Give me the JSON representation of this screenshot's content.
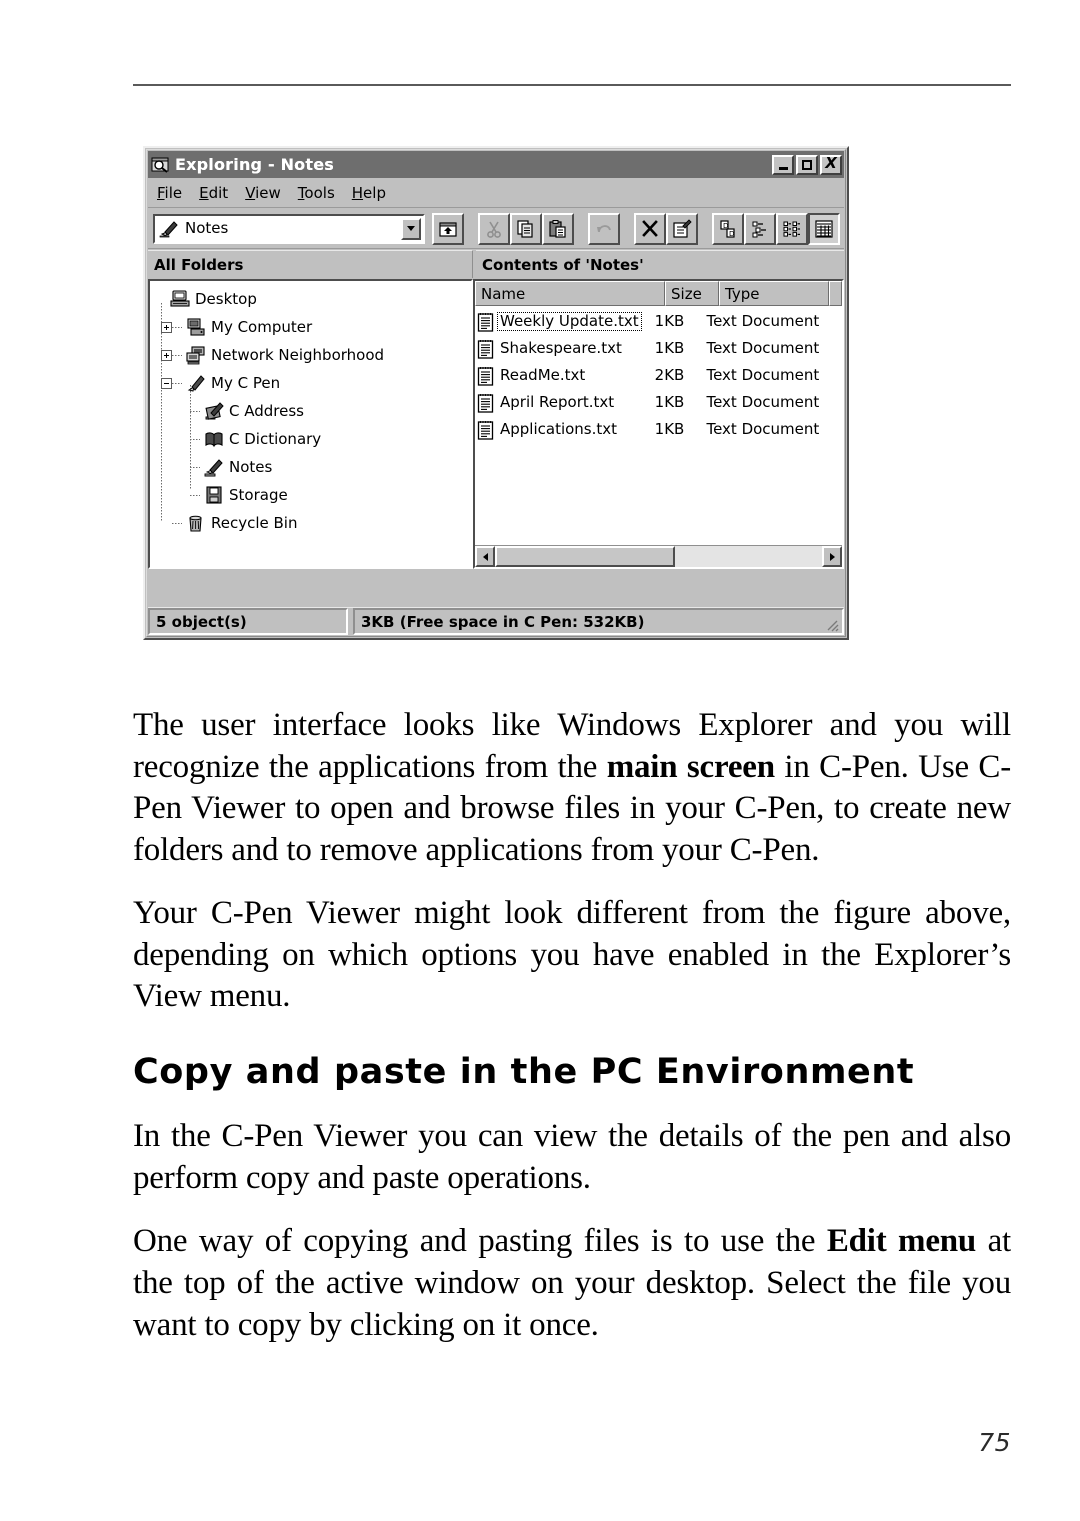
{
  "page": {
    "number": "75"
  },
  "window": {
    "title": "Exploring - Notes",
    "title_icon": "explorer-folder-magnifier-icon",
    "buttons": {
      "minimize": "minimize-button",
      "maximize": "maximize-button",
      "close": "close-button",
      "close_label": "X"
    },
    "menu": [
      {
        "label": "File",
        "accel": "F",
        "rest": "ile"
      },
      {
        "label": "Edit",
        "accel": "E",
        "rest": "dit"
      },
      {
        "label": "View",
        "accel": "V",
        "rest": "iew"
      },
      {
        "label": "Tools",
        "accel": "T",
        "rest": "ools"
      },
      {
        "label": "Help",
        "accel": "H",
        "rest": "elp"
      }
    ],
    "addressbar": {
      "value": "Notes",
      "icon": "notes-pen-icon",
      "dropdown": "chevron-down-icon"
    },
    "toolbar_buttons": [
      {
        "name": "up-one-level-button",
        "tooltip": "Up One Level",
        "enabled": true,
        "pressed": false
      },
      {
        "name": "cut-button",
        "tooltip": "Cut",
        "enabled": false,
        "pressed": false
      },
      {
        "name": "copy-button",
        "tooltip": "Copy",
        "enabled": true,
        "pressed": false
      },
      {
        "name": "paste-button",
        "tooltip": "Paste",
        "enabled": true,
        "pressed": false
      },
      {
        "name": "undo-button",
        "tooltip": "Undo",
        "enabled": false,
        "pressed": false
      },
      {
        "name": "delete-button",
        "tooltip": "Delete",
        "enabled": true,
        "pressed": false
      },
      {
        "name": "properties-button",
        "tooltip": "Properties",
        "enabled": true,
        "pressed": false
      },
      {
        "name": "large-icons-button",
        "tooltip": "Large Icons",
        "enabled": true,
        "pressed": false
      },
      {
        "name": "small-icons-button",
        "tooltip": "Small Icons",
        "enabled": true,
        "pressed": false
      },
      {
        "name": "list-view-button",
        "tooltip": "List",
        "enabled": true,
        "pressed": false
      },
      {
        "name": "details-view-button",
        "tooltip": "Details",
        "enabled": true,
        "pressed": true
      }
    ],
    "panes": {
      "left_header": "All Folders",
      "right_header": "Contents of 'Notes'"
    },
    "tree": [
      {
        "label": "Desktop",
        "depth": 0,
        "toggle": "none",
        "icon": "desktop-icon"
      },
      {
        "label": "My Computer",
        "depth": 1,
        "toggle": "plus",
        "icon": "my-computer-icon"
      },
      {
        "label": "Network Neighborhood",
        "depth": 1,
        "toggle": "plus",
        "icon": "network-neighborhood-icon"
      },
      {
        "label": "My C Pen",
        "depth": 1,
        "toggle": "minus",
        "icon": "c-pen-icon"
      },
      {
        "label": "C Address",
        "depth": 2,
        "toggle": "none",
        "icon": "c-address-icon"
      },
      {
        "label": "C Dictionary",
        "depth": 2,
        "toggle": "none",
        "icon": "c-dictionary-icon"
      },
      {
        "label": "Notes",
        "depth": 2,
        "toggle": "none",
        "icon": "notes-pen-icon"
      },
      {
        "label": "Storage",
        "depth": 2,
        "toggle": "none",
        "icon": "storage-icon"
      },
      {
        "label": "Recycle Bin",
        "depth": 1,
        "toggle": "none",
        "icon": "recycle-bin-icon"
      }
    ],
    "list": {
      "columns": [
        "Name",
        "Size",
        "Type"
      ],
      "rows": [
        {
          "name": "Weekly Update.txt",
          "size": "1KB",
          "type": "Text Document",
          "icon": "text-document-icon",
          "focused": true
        },
        {
          "name": "Shakespeare.txt",
          "size": "1KB",
          "type": "Text Document",
          "icon": "text-document-icon",
          "focused": false
        },
        {
          "name": "ReadMe.txt",
          "size": "2KB",
          "type": "Text Document",
          "icon": "text-document-icon",
          "focused": false
        },
        {
          "name": "April Report.txt",
          "size": "1KB",
          "type": "Text Document",
          "icon": "text-document-icon",
          "focused": false
        },
        {
          "name": "Applications.txt",
          "size": "1KB",
          "type": "Text Document",
          "icon": "text-document-icon",
          "focused": false
        }
      ]
    },
    "scrollbar": {
      "left_arrow": "scroll-left-icon",
      "right_arrow": "scroll-right-icon"
    },
    "status": {
      "objects": "5 object(s)",
      "details": "3KB (Free space in C Pen: 532KB)"
    }
  },
  "content": {
    "para1_a": "The user interface looks like Windows Explorer and you will recognize the applications from the ",
    "para1_b": "main screen",
    "para1_c": " in C-Pen. Use C-Pen Viewer to open and browse files in your C-Pen, to create new folders and to remove applications from your C-Pen.",
    "para2": "Your C-Pen Viewer might look different from the figure above, depending on which options you have enabled in the Explorer’s View menu.",
    "heading": "Copy and paste in the PC Environment",
    "para3": "In the C-Pen Viewer you can view the details of the pen and also perform copy and paste operations.",
    "para4_a": "One way of copying and pasting files is to use the ",
    "para4_b": "Edit menu",
    "para4_c": " at the top of the active window on your desktop. Select the file you want to copy by clicking on it once."
  }
}
